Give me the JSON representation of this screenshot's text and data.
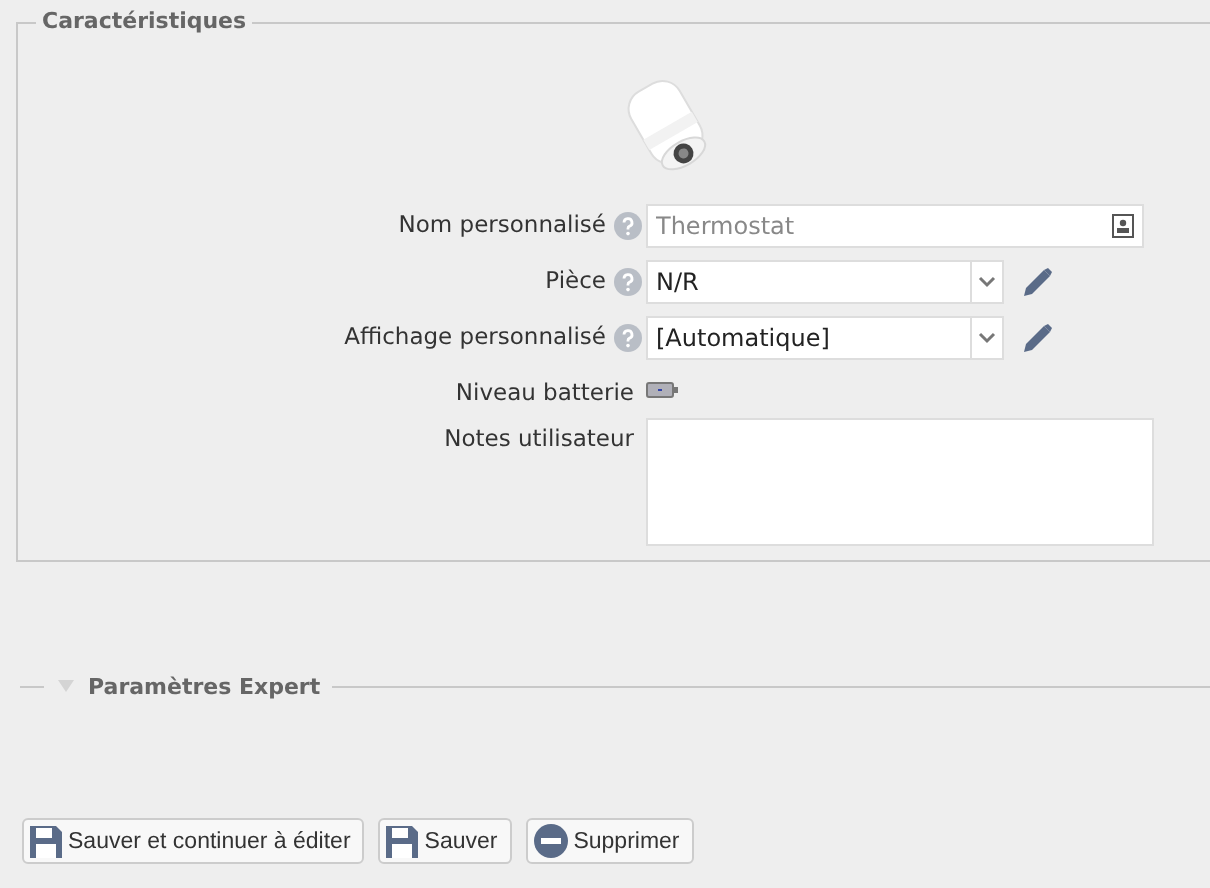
{
  "section": {
    "title": "Caractéristiques",
    "fields": [
      {
        "kind": "text",
        "label": "Nom personnalisé",
        "help": true,
        "placeholder": "Thermostat"
      },
      {
        "kind": "select",
        "label": "Pièce",
        "help": true,
        "value": "N/R",
        "editable": true
      },
      {
        "kind": "select",
        "label": "Affichage personnalisé",
        "help": true,
        "value": "[Automatique]",
        "editable": true
      },
      {
        "kind": "battery",
        "label": "Niveau batterie",
        "help": false
      },
      {
        "kind": "textarea",
        "label": "Notes utilisateur",
        "help": false
      }
    ]
  },
  "expert": {
    "title": "Paramètres Expert",
    "expanded": false
  },
  "buttons": [
    {
      "kind": "save",
      "label": "Sauver et continuer à éditer"
    },
    {
      "kind": "save",
      "label": "Sauver"
    },
    {
      "kind": "delete",
      "label": "Supprimer"
    }
  ]
}
